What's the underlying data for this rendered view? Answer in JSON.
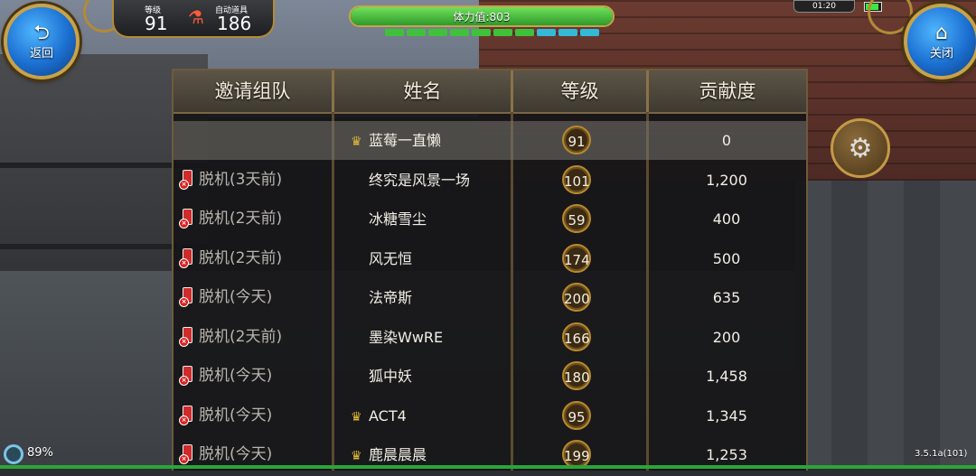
{
  "hud": {
    "back_label": "返回",
    "close_label": "关闭",
    "level_label": "等级",
    "level_value": "91",
    "auto_items_label": "自动道具",
    "auto_items_value": "186",
    "stamina_text": "体力值:803",
    "stamina_ratio": 1.0,
    "pips": [
      "#3fc23a",
      "#3fc23a",
      "#3fc23a",
      "#3fc23a",
      "#3fc23a",
      "#3fc23a",
      "#3fc23a",
      "#34b9d9",
      "#34b9d9",
      "#34b9d9"
    ],
    "clock": "01:20"
  },
  "table": {
    "headers": [
      "邀请组队",
      "姓名",
      "等级",
      "贡献度"
    ],
    "rows": [
      {
        "status": "",
        "name": "蓝莓一直懒",
        "crown": true,
        "level": "91",
        "contribution": "0",
        "highlight": true
      },
      {
        "status": "脱机(3天前)",
        "name": "终究是风景一场",
        "crown": false,
        "level": "101",
        "contribution": "1,200"
      },
      {
        "status": "脱机(2天前)",
        "name": "冰糖雪尘",
        "crown": false,
        "level": "59",
        "contribution": "400"
      },
      {
        "status": "脱机(2天前)",
        "name": "风无恒",
        "crown": false,
        "level": "174",
        "contribution": "500"
      },
      {
        "status": "脱机(今天)",
        "name": "法帝斯",
        "crown": false,
        "level": "200",
        "contribution": "635"
      },
      {
        "status": "脱机(2天前)",
        "name": "墨染WwRE",
        "crown": false,
        "level": "166",
        "contribution": "200"
      },
      {
        "status": "脱机(今天)",
        "name": "狐中妖",
        "crown": false,
        "level": "180",
        "contribution": "1,458"
      },
      {
        "status": "脱机(今天)",
        "name": "ACT4",
        "crown": true,
        "level": "95",
        "contribution": "1,345"
      },
      {
        "status": "脱机(今天)",
        "name": "鹿晨晨晨",
        "crown": true,
        "level": "199",
        "contribution": "1,253"
      }
    ]
  },
  "footer": {
    "percent": "89%",
    "version": "3.5.1a(101)"
  },
  "icons": {
    "back": "back-arrow-icon",
    "close": "home-icon",
    "settings": "gear-icon",
    "offline": "offline-phone-icon",
    "leader": "crown-icon"
  }
}
